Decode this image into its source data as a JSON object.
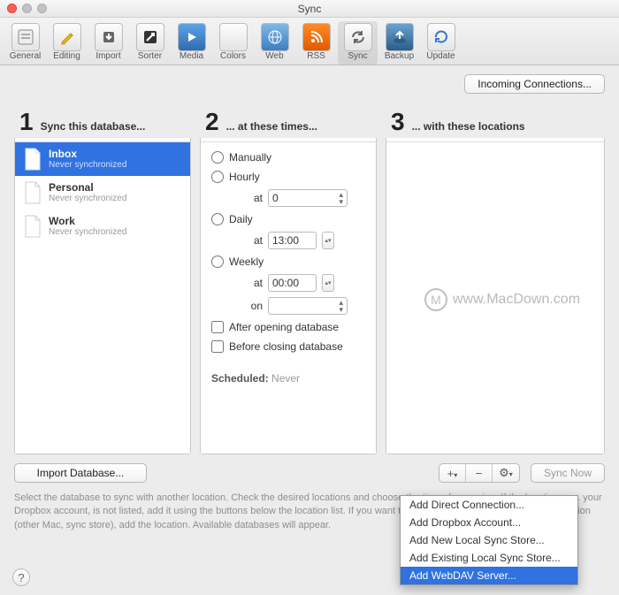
{
  "window": {
    "title": "Sync"
  },
  "toolbar": {
    "items": [
      {
        "label": "General"
      },
      {
        "label": "Editing"
      },
      {
        "label": "Import"
      },
      {
        "label": "Sorter"
      },
      {
        "label": "Media"
      },
      {
        "label": "Colors"
      },
      {
        "label": "Web"
      },
      {
        "label": "RSS"
      },
      {
        "label": "Sync"
      },
      {
        "label": "Backup"
      },
      {
        "label": "Update"
      }
    ]
  },
  "incoming_btn": "Incoming Connections...",
  "col1": {
    "num": "1",
    "title": "Sync this database...",
    "items": [
      {
        "name": "Inbox",
        "sub": "Never synchronized"
      },
      {
        "name": "Personal",
        "sub": "Never synchronized"
      },
      {
        "name": "Work",
        "sub": "Never synchronized"
      }
    ]
  },
  "col2": {
    "num": "2",
    "title": "... at these times...",
    "manually": "Manually",
    "hourly": "Hourly",
    "hourly_at_label": "at",
    "hourly_at": "0",
    "daily": "Daily",
    "daily_at_label": "at",
    "daily_at": "13:00",
    "weekly": "Weekly",
    "weekly_at_label": "at",
    "weekly_at": "00:00",
    "weekly_on_label": "on",
    "weekly_on": "",
    "after": "After opening database",
    "before": "Before closing database",
    "sched_label": "Scheduled:",
    "sched_val": "Never"
  },
  "col3": {
    "num": "3",
    "title": "... with these locations"
  },
  "import_btn": "Import Database...",
  "add_btn": "+",
  "remove_btn": "−",
  "gear_btn": "✽",
  "sync_now_btn": "Sync Now",
  "popup": {
    "items": [
      "Add Direct Connection...",
      "Add Dropbox Account...",
      "Add New Local Sync Store...",
      "Add Existing Local Sync Store...",
      "Add WebDAV Server..."
    ]
  },
  "help_text": "Select the database to sync with another location. Check the desired locations and choose the times for syncing. If the location, e.g. your Dropbox account, is not listed, add it using the buttons below the location list. If you want to sync your database with a remote location (other Mac, sync store), add the location. Available databases will appear.",
  "watermark": "www.MacDown.com"
}
